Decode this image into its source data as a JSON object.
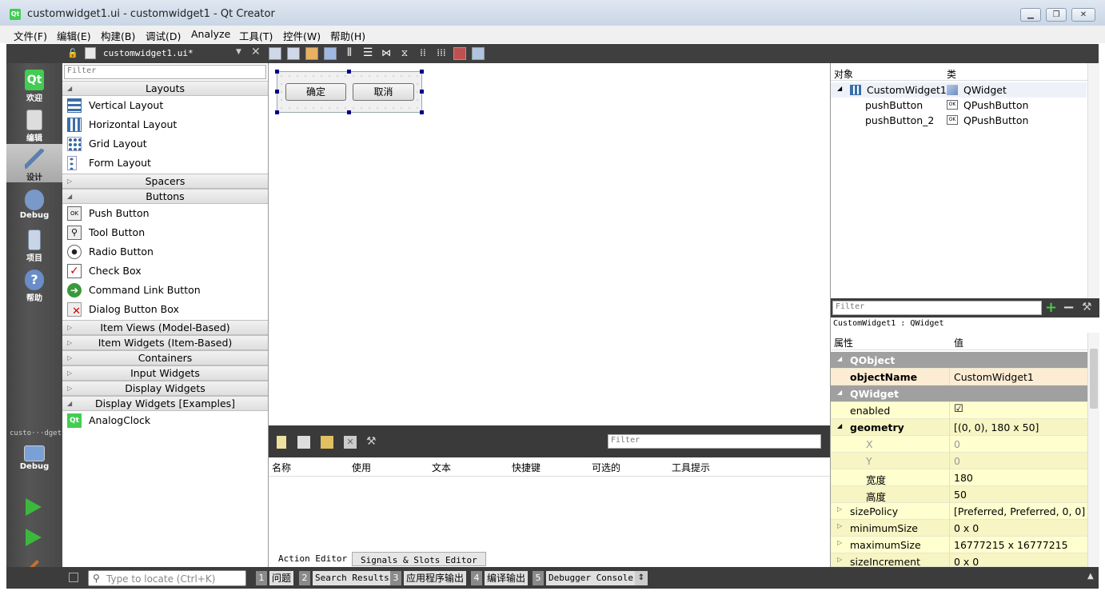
{
  "window": {
    "title": "customwidget1.ui - customwidget1 - Qt Creator",
    "app_icon": "Qt"
  },
  "menu": [
    "文件(F)",
    "编辑(E)",
    "构建(B)",
    "调试(D)",
    "Analyze",
    "工具(T)",
    "控件(W)",
    "帮助(H)"
  ],
  "toolbar": {
    "file_name": "customwidget1.ui*"
  },
  "modes": [
    {
      "label": "欢迎",
      "icon": "qt-logo-icon"
    },
    {
      "label": "编辑",
      "icon": "document-icon"
    },
    {
      "label": "设计",
      "icon": "design-pencil-icon",
      "active": true
    },
    {
      "label": "Debug",
      "icon": "debug-bug-icon"
    },
    {
      "label": "项目",
      "icon": "project-icon"
    },
    {
      "label": "帮助",
      "icon": "help-icon"
    }
  ],
  "target": {
    "name": "custo···dget1",
    "mode": "Debug"
  },
  "widgetbox": {
    "filter_placeholder": "Filter",
    "categories": [
      {
        "name": "Layouts",
        "expanded": true,
        "items": [
          "Vertical Layout",
          "Horizontal Layout",
          "Grid Layout",
          "Form Layout"
        ]
      },
      {
        "name": "Spacers",
        "expanded": false
      },
      {
        "name": "Buttons",
        "expanded": true,
        "items": [
          "Push Button",
          "Tool Button",
          "Radio Button",
          "Check Box",
          "Command Link Button",
          "Dialog Button Box"
        ]
      },
      {
        "name": "Item Views (Model-Based)",
        "expanded": false
      },
      {
        "name": "Item Widgets (Item-Based)",
        "expanded": false
      },
      {
        "name": "Containers",
        "expanded": false
      },
      {
        "name": "Input Widgets",
        "expanded": false
      },
      {
        "name": "Display Widgets",
        "expanded": false
      },
      {
        "name": "Display Widgets [Examples]",
        "expanded": true,
        "items": [
          "AnalogClock"
        ]
      }
    ]
  },
  "form": {
    "ok_button": "确定",
    "cancel_button": "取消"
  },
  "action_editor": {
    "filter_placeholder": "Filter",
    "columns": [
      "名称",
      "使用",
      "文本",
      "快捷键",
      "可选的",
      "工具提示"
    ],
    "tabs": [
      "Action Editor",
      "Signals & Slots Editor"
    ]
  },
  "object_inspector": {
    "columns": [
      "对象",
      "类"
    ],
    "rows": [
      {
        "name": "CustomWidget1",
        "class": "QWidget"
      },
      {
        "name": "pushButton",
        "class": "QPushButton"
      },
      {
        "name": "pushButton_2",
        "class": "QPushButton"
      }
    ]
  },
  "property_editor": {
    "filter_placeholder": "Filter",
    "context": "CustomWidget1 : QWidget",
    "columns": [
      "属性",
      "值"
    ],
    "rows": [
      {
        "key": "QObject",
        "value": "",
        "type": "group"
      },
      {
        "key": "objectName",
        "value": "CustomWidget1",
        "type": "hl"
      },
      {
        "key": "QWidget",
        "value": "",
        "type": "group"
      },
      {
        "key": "enabled",
        "value": "☑",
        "type": "y1"
      },
      {
        "key": "geometry",
        "value": "[(0, 0), 180 x 50]",
        "type": "y2"
      },
      {
        "key": "X",
        "value": "0",
        "type": "y1",
        "sub": true
      },
      {
        "key": "Y",
        "value": "0",
        "type": "y2",
        "sub": true
      },
      {
        "key": "宽度",
        "value": "180",
        "type": "y1",
        "sub": true
      },
      {
        "key": "高度",
        "value": "50",
        "type": "y2",
        "sub": true
      },
      {
        "key": "sizePolicy",
        "value": "[Preferred, Preferred, 0, 0]",
        "type": "y1"
      },
      {
        "key": "minimumSize",
        "value": "0 x 0",
        "type": "y2"
      },
      {
        "key": "maximumSize",
        "value": "16777215 x 16777215",
        "type": "y1"
      },
      {
        "key": "sizeIncrement",
        "value": "0 x 0",
        "type": "y2"
      }
    ]
  },
  "statusbar": {
    "locate_placeholder": "Type to locate (Ctrl+K)",
    "tabs": [
      {
        "num": "1",
        "label": "问题"
      },
      {
        "num": "2",
        "label": "Search Results"
      },
      {
        "num": "3",
        "label": "应用程序输出"
      },
      {
        "num": "4",
        "label": "编译输出"
      },
      {
        "num": "5",
        "label": "Debugger Console"
      }
    ]
  }
}
